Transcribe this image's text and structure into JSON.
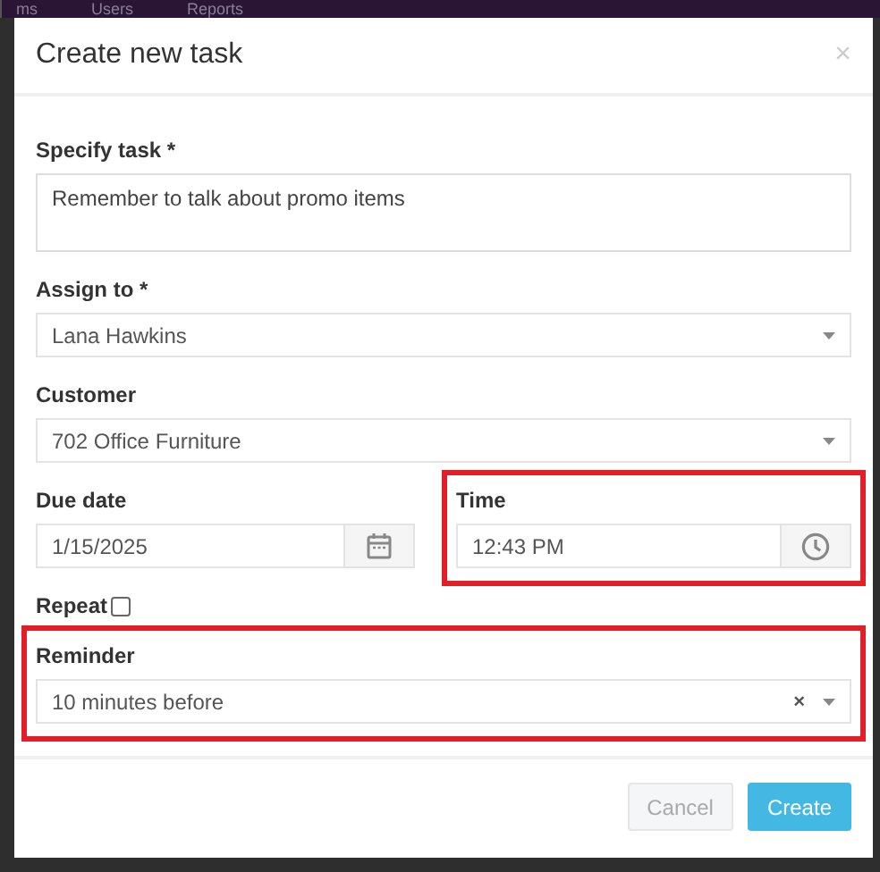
{
  "background_nav": [
    "ms",
    "Users",
    "Reports"
  ],
  "dialog": {
    "title": "Create new task",
    "close": "×"
  },
  "fields": [
    {
      "kind": "textarea",
      "label": "Specify task *",
      "value": "Remember to talk about promo items",
      "highlighted": false
    },
    {
      "kind": "select",
      "label": "Assign to *",
      "value": "Lana Hawkins",
      "highlighted": false
    },
    {
      "kind": "select",
      "label": "Customer",
      "value": "702 Office Furniture",
      "highlighted": false
    },
    {
      "kind": "pair",
      "items": [
        {
          "kind": "date",
          "label": "Due date",
          "value": "1/15/2025",
          "highlighted": false
        },
        {
          "kind": "time",
          "label": "Time",
          "value": "12:43 PM",
          "highlighted": true
        }
      ]
    },
    {
      "kind": "checkbox",
      "label": "Repeat",
      "checked": false,
      "highlighted": false
    },
    {
      "kind": "clearable",
      "label": "Reminder",
      "value": "10 minutes before",
      "clear": "×",
      "highlighted": true
    }
  ],
  "buttons": [
    {
      "label": "Cancel",
      "kind": "secondary"
    },
    {
      "label": "Create",
      "kind": "primary"
    }
  ]
}
